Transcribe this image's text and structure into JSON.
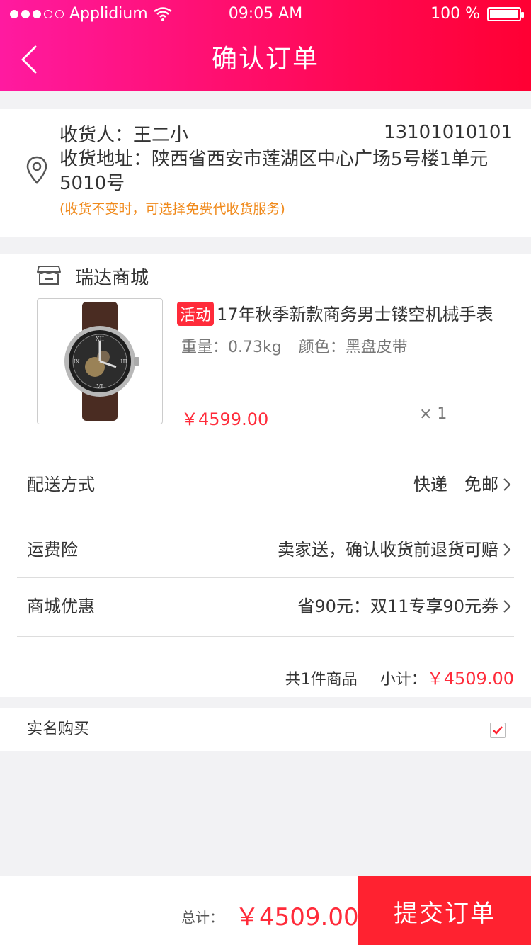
{
  "status_bar": {
    "carrier": "Applidium",
    "time": "09:05 AM",
    "battery": "100 %"
  },
  "nav": {
    "title": "确认订单"
  },
  "address": {
    "receiver": "收货人：王二小",
    "phone": "13101010101",
    "address": "收货地址：陕西省西安市莲湖区中心广场5号楼1单元5010号",
    "note": "(收货不变时，可选择免费代收货服务)"
  },
  "store": {
    "name": "瑞达商城"
  },
  "product": {
    "badge": "活动",
    "title": "17年秋季新款商务男士镂空机械手表",
    "weight": "重量：0.73kg",
    "color": "颜色：黑盘皮带",
    "price": "￥4599.00",
    "qty": "× 1"
  },
  "rows": [
    {
      "label": "配送方式",
      "value": "快递　免邮"
    },
    {
      "label": "运费险",
      "value": "卖家送，确认收货前退货可赔"
    },
    {
      "label": "商城优惠",
      "value": "省90元：双11专享90元券"
    }
  ],
  "summary": {
    "count": "共1件商品",
    "subtotal_label": "小计：",
    "subtotal_amount": "￥4509.00"
  },
  "realname": {
    "label": "实名购买",
    "checked": true
  },
  "bottom": {
    "total_label": "总计：",
    "total_amount": "￥4509.00",
    "submit_label": "提交订单"
  },
  "colors": {
    "accent": "#ff2230",
    "header_start": "#ff1aa0",
    "header_end": "#ff0033",
    "note": "#f08a1c"
  }
}
